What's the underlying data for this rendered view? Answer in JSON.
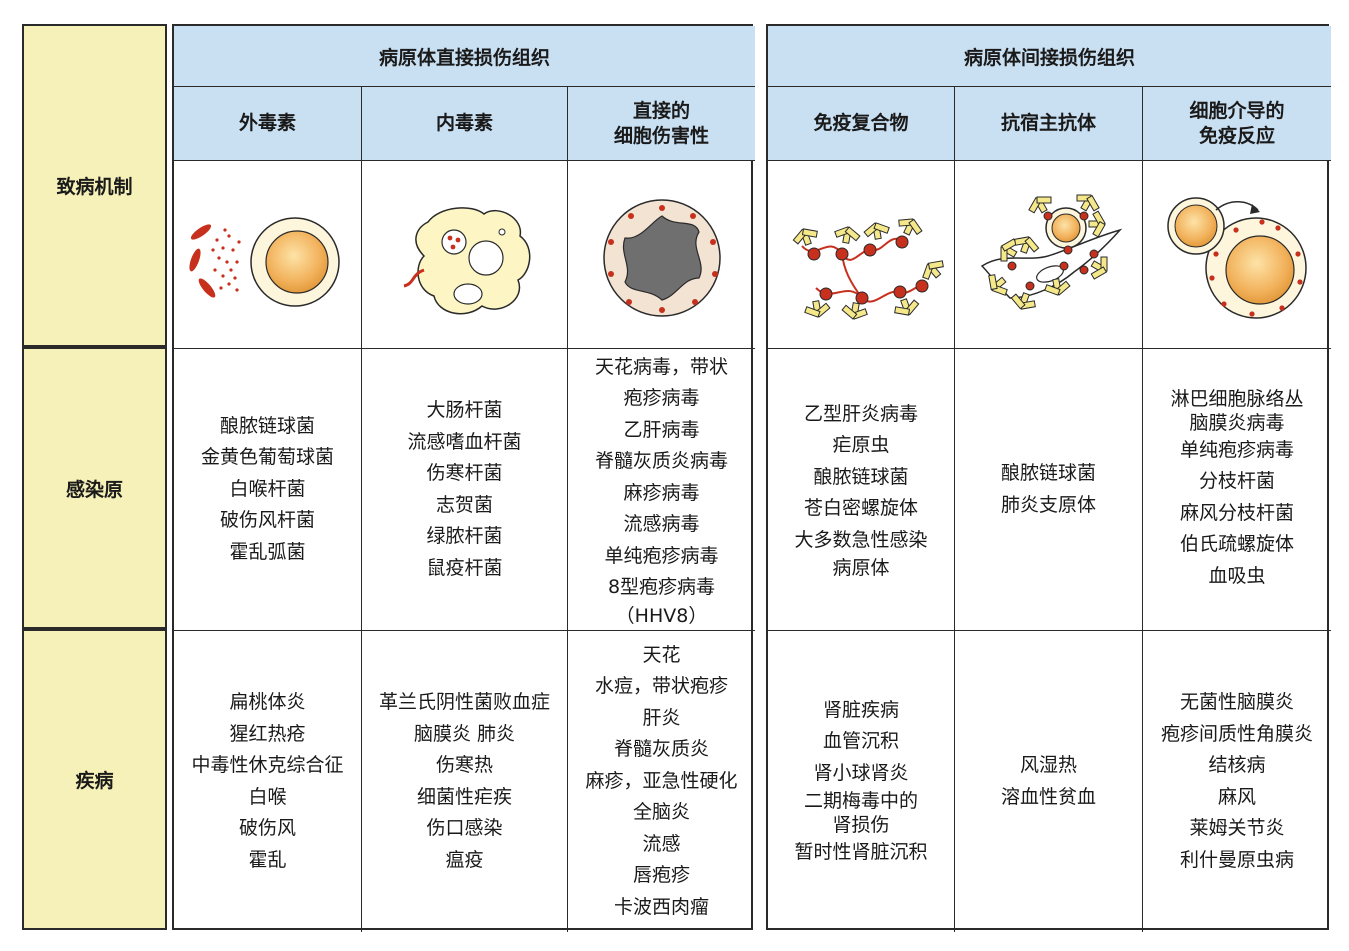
{
  "row_headers": {
    "mechanism": "致病机制",
    "agents": "感染原",
    "diseases": "疾病"
  },
  "groups": {
    "direct": "病原体直接损伤组织",
    "indirect": "病原体间接损伤组织"
  },
  "columns": [
    {
      "title": "外毒素",
      "illustration_icon": "exotoxin-release-icon",
      "agents": [
        "酿脓链球菌",
        "金黄色葡萄球菌",
        "白喉杆菌",
        "破伤风杆菌",
        "霍乱弧菌"
      ],
      "diseases": [
        "扁桃体炎",
        "猩红热疮",
        "中毒性休克综合征",
        "白喉",
        "破伤风",
        "霍乱"
      ]
    },
    {
      "title": "内毒素",
      "illustration_icon": "endotoxin-macrophage-icon",
      "agents": [
        "大肠杆菌",
        "流感嗜血杆菌",
        "伤寒杆菌",
        "志贺菌",
        "绿脓杆菌",
        "鼠疫杆菌"
      ],
      "diseases": [
        "革兰氏阴性菌败血症",
        "脑膜炎 肺炎",
        "伤寒热",
        "细菌性疟疾",
        "伤口感染",
        "瘟疫"
      ]
    },
    {
      "title": "直接的\n细胞伤害性",
      "illustration_icon": "infected-cell-icon",
      "agents": [
        "天花病毒，带状",
        "疱疹病毒",
        "乙肝病毒",
        "脊髓灰质炎病毒",
        "麻疹病毒",
        "流感病毒",
        "单纯疱疹病毒",
        "8型疱疹病毒",
        "（HHV8）"
      ],
      "diseases": [
        "天花",
        "水痘，带状疱疹",
        "肝炎",
        "脊髓灰质炎",
        "麻疹，亚急性硬化",
        "全脑炎",
        "流感",
        "唇疱疹",
        "卡波西肉瘤"
      ]
    },
    {
      "title": "免疫复合物",
      "illustration_icon": "immune-complex-icon",
      "agents": [
        "乙型肝炎病毒",
        "疟原虫",
        "酿脓链球菌",
        "苍白密螺旋体",
        "大多数急性感染",
        "病原体"
      ],
      "diseases": [
        "肾脏疾病",
        "血管沉积",
        "肾小球肾炎",
        "二期梅毒中的",
        "肾损伤",
        "暂时性肾脏沉积"
      ]
    },
    {
      "title": "抗宿主抗体",
      "illustration_icon": "anti-host-antibody-icon",
      "agents": [
        "酿脓链球菌",
        "肺炎支原体"
      ],
      "diseases": [
        "风湿热",
        "溶血性贫血"
      ]
    },
    {
      "title": "细胞介导的\n免疫反应",
      "illustration_icon": "cell-mediated-immunity-icon",
      "agents": [
        "淋巴细胞脉络丛",
        "脑膜炎病毒",
        "单纯疱疹病毒",
        "分枝杆菌",
        "麻风分枝杆菌",
        "伯氏疏螺旋体",
        "血吸虫"
      ],
      "diseases": [
        "无菌性脑膜炎",
        "疱疹间质性角膜炎",
        "结核病",
        "麻风",
        "莱姆关节炎",
        "利什曼原虫病"
      ]
    }
  ],
  "colors": {
    "row_header_bg": "#f6f1b8",
    "column_header_bg": "#c9dff2",
    "border": "#2a2a2a",
    "pathogen_red": "#c8301e",
    "antibody_yellow": "#f4e88a",
    "nucleus_orange": "#f2b25c"
  }
}
